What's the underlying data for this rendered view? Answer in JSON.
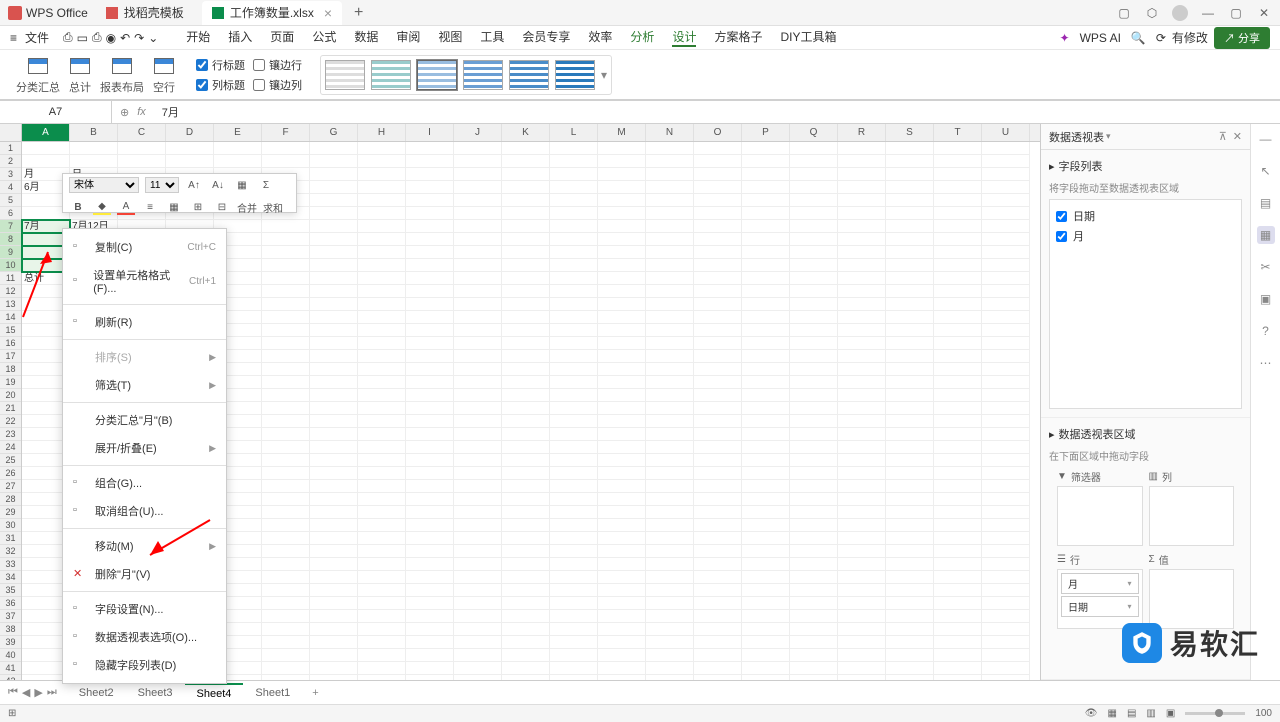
{
  "titlebar": {
    "app": "WPS Office",
    "tabs": [
      {
        "label": "找稻壳模板",
        "icon": "template"
      },
      {
        "label": "工作簿数量.xlsx",
        "icon": "xlsx",
        "active": true
      }
    ]
  },
  "menubar": {
    "file": "文件",
    "tabs": [
      "开始",
      "插入",
      "页面",
      "公式",
      "数据",
      "审阅",
      "视图",
      "工具",
      "会员专享",
      "效率",
      "分析",
      "设计",
      "方案格子",
      "DIY工具箱"
    ],
    "active_tab": "设计",
    "green_tabs": [
      "分析",
      "设计"
    ],
    "ai": "WPS AI",
    "has_changes": "有修改",
    "share": "分享"
  },
  "ribbon": {
    "groups": [
      "分类汇总",
      "总计",
      "报表布局",
      "空行"
    ],
    "options": {
      "row_header": "行标题",
      "alt_row": "镶边行",
      "col_header": "列标题",
      "alt_col": "镶边列"
    }
  },
  "formulabar": {
    "cell_ref": "A7",
    "value": "7月"
  },
  "columns": [
    "A",
    "B",
    "C",
    "D",
    "E",
    "F",
    "G",
    "H",
    "I",
    "J",
    "K",
    "L",
    "M",
    "N",
    "O",
    "P",
    "Q",
    "R",
    "S",
    "T",
    "U"
  ],
  "sheet_data": {
    "r3": {
      "A": "月",
      "B": "日"
    },
    "r4": {
      "A": "6月"
    },
    "r7": {
      "A": "7月",
      "B": "7月12日"
    },
    "r11": {
      "A": "总计"
    }
  },
  "mini_toolbar": {
    "font": "宋体",
    "size": "11",
    "merge": "合并",
    "sum": "求和"
  },
  "context_menu": [
    {
      "label": "复制(C)",
      "shortcut": "Ctrl+C",
      "icon": "copy"
    },
    {
      "label": "设置单元格格式(F)...",
      "shortcut": "Ctrl+1",
      "icon": "format"
    },
    {
      "sep": true
    },
    {
      "label": "刷新(R)",
      "icon": "refresh"
    },
    {
      "sep": true
    },
    {
      "label": "排序(S)",
      "disabled": true,
      "submenu": true
    },
    {
      "label": "筛选(T)",
      "submenu": true
    },
    {
      "sep": true
    },
    {
      "label": "分类汇总\"月\"(B)"
    },
    {
      "label": "展开/折叠(E)",
      "submenu": true
    },
    {
      "sep": true
    },
    {
      "label": "组合(G)...",
      "icon": "group"
    },
    {
      "label": "取消组合(U)...",
      "icon": "ungroup"
    },
    {
      "sep": true
    },
    {
      "label": "移动(M)",
      "submenu": true
    },
    {
      "label": "删除\"月\"(V)",
      "icon": "delete",
      "red": true
    },
    {
      "sep": true
    },
    {
      "label": "字段设置(N)...",
      "icon": "field"
    },
    {
      "label": "数据透视表选项(O)...",
      "icon": "pivot"
    },
    {
      "label": "隐藏字段列表(D)",
      "icon": "hide"
    }
  ],
  "pivot_panel": {
    "title": "数据透视表",
    "section1": "字段列表",
    "hint1": "将字段拖动至数据透视表区域",
    "fields": [
      {
        "label": "日期",
        "checked": true
      },
      {
        "label": "月",
        "checked": true
      }
    ],
    "section2": "数据透视表区域",
    "hint2": "在下面区域中拖动字段",
    "areas": {
      "filter": "筛选器",
      "columns": "列",
      "rows": "行",
      "values": "值"
    },
    "row_chips": [
      "月",
      "日期"
    ]
  },
  "sheets": {
    "tabs": [
      "Sheet2",
      "Sheet3",
      "Sheet4",
      "Sheet1"
    ],
    "active": "Sheet4"
  },
  "statusbar": {
    "zoom": "100"
  },
  "watermark": "易软汇"
}
